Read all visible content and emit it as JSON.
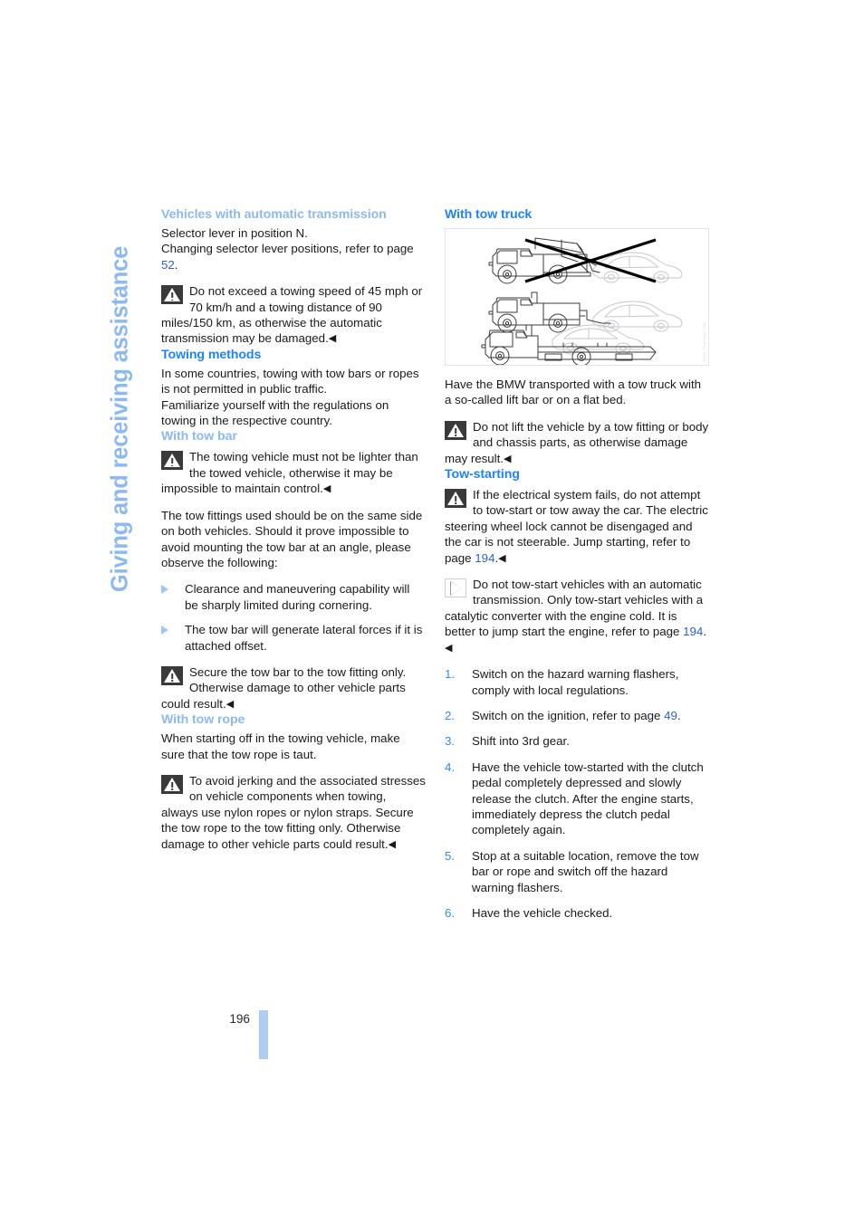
{
  "chapter": {
    "vertical_title": "Giving and receiving assistance"
  },
  "footer": {
    "page_number": "196"
  },
  "left_column": {
    "heading_auto_trans": "Vehicles with automatic transmission",
    "auto_trans_p1_a": "Selector lever in position N.",
    "auto_trans_p1_b": "Changing selector lever positions, refer to page ",
    "auto_trans_p1_link": "52",
    "auto_trans_p1_c": ".",
    "auto_trans_warning": "Do not exceed a towing speed of 45 mph or 70 km/h and a towing distance of 90 miles/150 km, as otherwise the automatic transmission may be damaged.",
    "heading_towing_methods": "Towing methods",
    "towing_methods_p1": "In some countries, towing with tow bars or ropes is not permitted in public traffic.",
    "towing_methods_p2": "Familiarize yourself with the regulations on towing in the respective country.",
    "heading_tow_bar": "With tow bar",
    "tow_bar_warning1": "The towing vehicle must not be lighter than the towed vehicle, otherwise it may be impossible to maintain control.",
    "tow_bar_p1": "The tow fittings used should be on the same side on both vehicles. Should it prove impossible to avoid mounting the tow bar at an angle, please observe the following:",
    "tow_bar_bullets": [
      "Clearance and maneuvering capability will be sharply limited during cornering.",
      "The tow bar will generate lateral forces if it is attached offset."
    ],
    "tow_bar_warning2": "Secure the tow bar to the tow fitting only. Otherwise damage to other vehicle parts could result.",
    "heading_tow_rope": "With tow rope",
    "tow_rope_p1": "When starting off in the towing vehicle, make sure that the tow rope is taut.",
    "tow_rope_warning": "To avoid jerking and the associated stresses on vehicle components when towing, always use nylon ropes or nylon straps. Secure the tow rope to the tow fitting only. Otherwise damage to other vehicle parts could result."
  },
  "right_column": {
    "heading_tow_truck": "With tow truck",
    "illustration": {
      "alt": "Three tow truck methods: crane/hook tow crossed out, lift bar tow, flat bed tow",
      "credit": "BMW_TowTruck_196"
    },
    "tow_truck_p1": "Have the BMW transported with a tow truck with a so-called lift bar or on a flat bed.",
    "tow_truck_warning": "Do not lift the vehicle by a tow fitting or body and chassis parts, as otherwise damage may result.",
    "heading_tow_starting": "Tow-starting",
    "tow_start_warning_a": "If the electrical system fails, do not attempt to tow-start or tow away the car. The electric steering wheel lock cannot be disengaged and the car is not steerable. Jump starting, refer to page ",
    "tow_start_warning_link": "194",
    "tow_start_warning_b": ".",
    "tow_start_note_a": "Do not tow-start vehicles with an automatic transmission. Only tow-start vehicles with a catalytic converter with the engine cold. It is better to jump start the engine, refer to page ",
    "tow_start_note_link": "194",
    "tow_start_note_b": ".",
    "steps": [
      {
        "num": "1.",
        "text": "Switch on the hazard warning flashers, comply with local regulations.",
        "link": null
      },
      {
        "num": "2.",
        "text_before": "Switch on the ignition, refer to page ",
        "link": "49",
        "text_after": "."
      },
      {
        "num": "3.",
        "text": "Shift into 3rd gear.",
        "link": null
      },
      {
        "num": "4.",
        "text": "Have the vehicle tow-started with the clutch pedal completely depressed and slowly release the clutch. After the engine starts, immediately depress the clutch pedal completely again.",
        "link": null
      },
      {
        "num": "5.",
        "text": "Stop at a suitable location, remove the tow bar or rope and switch off the hazard warning flashers.",
        "link": null
      },
      {
        "num": "6.",
        "text": "Have the vehicle checked.",
        "link": null
      }
    ]
  },
  "symbols": {
    "end_mark": "◀",
    "warning_icon": "warning-triangle-icon",
    "note_icon": "note-play-icon",
    "bullet_icon": "triangle-bullet-icon"
  },
  "colors": {
    "heading_blue": "#1e84f5",
    "subheading_blue": "#8cbaf0",
    "link_blue": "#2b61d1",
    "step_number_blue": "#2f8bf0",
    "tab_blue": "#aecdf5"
  }
}
